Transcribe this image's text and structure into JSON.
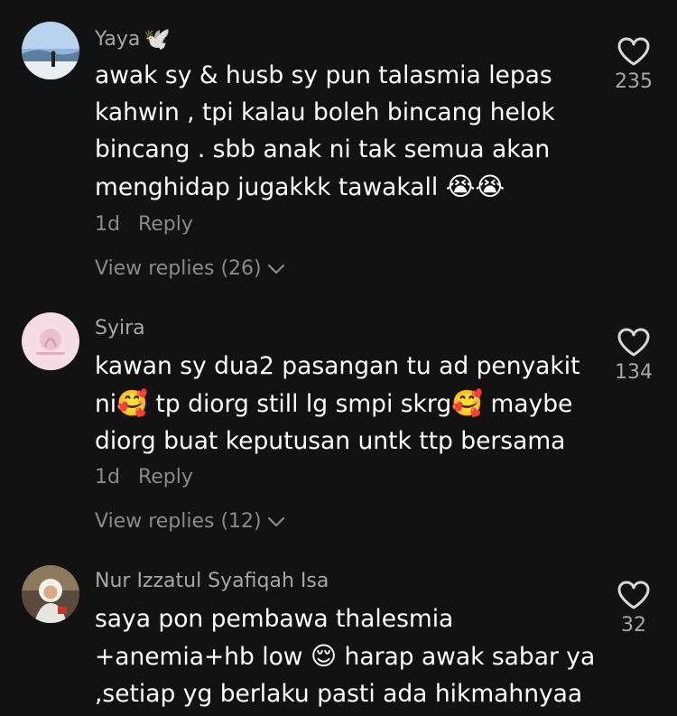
{
  "comments": [
    {
      "username": "Yaya",
      "username_badge": "🕊️",
      "lines": [
        "awak sy & husb sy pun talasmia lepas",
        "kahwin , tpi kalau boleh bincang helok",
        "bincang . sbb anak ni tak semua akan",
        "menghidap jugakkk tawakall"
      ],
      "line4_emoji": "😭😭",
      "time": "1d",
      "reply_label": "Reply",
      "view_replies": "View replies (26)",
      "like_count": "235"
    },
    {
      "username": "Syira",
      "lines": [
        "kawan sy dua2 pasangan tu ad penyakit",
        "ni",
        "tp diorg still lg smpi skrg",
        "maybe",
        "diorg buat keputusan untk ttp bersama"
      ],
      "emoji": "🥰",
      "time": "1d",
      "reply_label": "Reply",
      "view_replies": "View replies (12)",
      "like_count": "134"
    },
    {
      "username": "Nur Izzatul Syafiqah Isa",
      "lines": [
        "saya pon pembawa thalesmia",
        "+anemia+hb low",
        "harap awak sabar ya",
        ",setiap yg berlaku pasti ada hikmahnyaa"
      ],
      "emoji": "😌",
      "like_count": "32"
    }
  ],
  "colors": {
    "background": "#121212",
    "text": "#ffffff",
    "secondary": "#8a8a8c"
  },
  "icons": [
    "heart-icon",
    "chevron-down-icon"
  ]
}
